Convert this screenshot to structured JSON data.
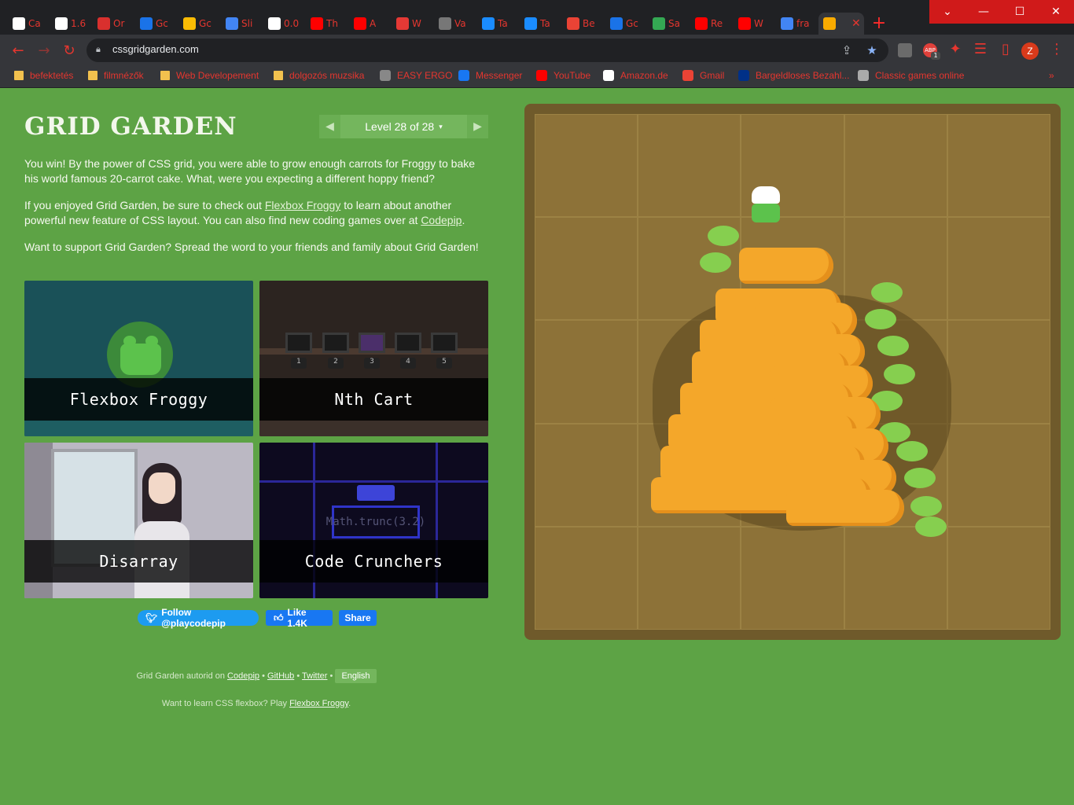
{
  "browser": {
    "tabs": [
      {
        "title": "Ca",
        "color": "#ffffff"
      },
      {
        "title": "1.6",
        "color": "#ffffff"
      },
      {
        "title": "Or",
        "color": "#d9302e"
      },
      {
        "title": "Gc",
        "color": "#1a73e8"
      },
      {
        "title": "Gc",
        "color": "#fbbc04"
      },
      {
        "title": "Sli",
        "color": "#4285f4"
      },
      {
        "title": "0.0",
        "color": "#ffffff"
      },
      {
        "title": "Th",
        "color": "#ff0000"
      },
      {
        "title": "A",
        "color": "#ff0000"
      },
      {
        "title": "W",
        "color": "#e53935"
      },
      {
        "title": "Va",
        "color": "#777777"
      },
      {
        "title": "Ta",
        "color": "#1a8cff"
      },
      {
        "title": "Ta",
        "color": "#1a8cff"
      },
      {
        "title": "Be",
        "color": "#ea4335"
      },
      {
        "title": "Gc",
        "color": "#1a73e8"
      },
      {
        "title": "Sa",
        "color": "#34a853"
      },
      {
        "title": "Re",
        "color": "#ff0000"
      },
      {
        "title": "W",
        "color": "#ff0000"
      },
      {
        "title": "fra",
        "color": "#4285f4"
      },
      {
        "title": "",
        "color": "#f9ab00"
      }
    ],
    "active_tab_close": "✕",
    "new_tab": "+",
    "window_controls": {
      "dropdown": "⌄",
      "minimize": "—",
      "maximize": "☐",
      "close": "✕"
    },
    "url": "cssgridgarden.com",
    "bookmarks": [
      {
        "label": "befektetés",
        "kind": "folder"
      },
      {
        "label": "filmnézők",
        "kind": "folder"
      },
      {
        "label": "Web Developement",
        "kind": "folder"
      },
      {
        "label": "dolgozós muzsika",
        "kind": "folder"
      },
      {
        "label": "EASY ERGO",
        "kind": "site",
        "color": "#888888"
      },
      {
        "label": "Messenger",
        "kind": "site",
        "color": "#1877f2"
      },
      {
        "label": "YouTube",
        "kind": "site",
        "color": "#ff0000"
      },
      {
        "label": "Amazon.de",
        "kind": "site",
        "color": "#ffffff"
      },
      {
        "label": "Gmail",
        "kind": "site",
        "color": "#ea4335"
      },
      {
        "label": "Bargeldloses Bezahl...",
        "kind": "site",
        "color": "#003087"
      },
      {
        "label": "Classic games online",
        "kind": "site",
        "color": "#aaaaaa"
      }
    ],
    "avatar_initial": "Z",
    "badge_label": "ABP",
    "badge_count": "1",
    "more_bookmarks": "»"
  },
  "game": {
    "title": "GRID GARDEN",
    "level_label": "Level 28 of 28",
    "prev_arrow": "◀",
    "next_arrow": "▶",
    "caret": "▾",
    "intro": "You win! By the power of CSS grid, you were able to grow enough carrots for Froggy to bake his world famous 20-carrot cake. What, were you expecting a different hoppy friend?",
    "p2_before": "If you enjoyed Grid Garden, be sure to check out ",
    "p2_link1": "Flexbox Froggy",
    "p2_middle": " to learn about another powerful new feature of CSS layout. You can also find new coding games over at ",
    "p2_link2": "Codepip",
    "p2_after": ".",
    "p3": "Want to support Grid Garden? Spread the word to your friends and family about Grid Garden!",
    "cards": [
      {
        "label": "Flexbox Froggy"
      },
      {
        "label": "Nth Cart"
      },
      {
        "label": "Disarray"
      },
      {
        "label": "Code Crunchers"
      }
    ],
    "cart_numbers": [
      "1",
      "2",
      "3",
      "4",
      "5"
    ],
    "crunch_code": "Math.trunc(3.2)",
    "twitter_label": "Follow @playcodepip",
    "fb_like_label": "Like 1.4K",
    "fb_share_label": "Share"
  },
  "footer": {
    "credit_prefix": "Grid Garden autorid on ",
    "credit_codepip": "Codepip",
    "credit_github": "GitHub",
    "credit_twitter": "Twitter",
    "bullet": "•",
    "language": "English",
    "flexbox_prefix": "Want to learn CSS flexbox? Play ",
    "flexbox_link": "Flexbox Froggy",
    "flexbox_suffix": "."
  }
}
